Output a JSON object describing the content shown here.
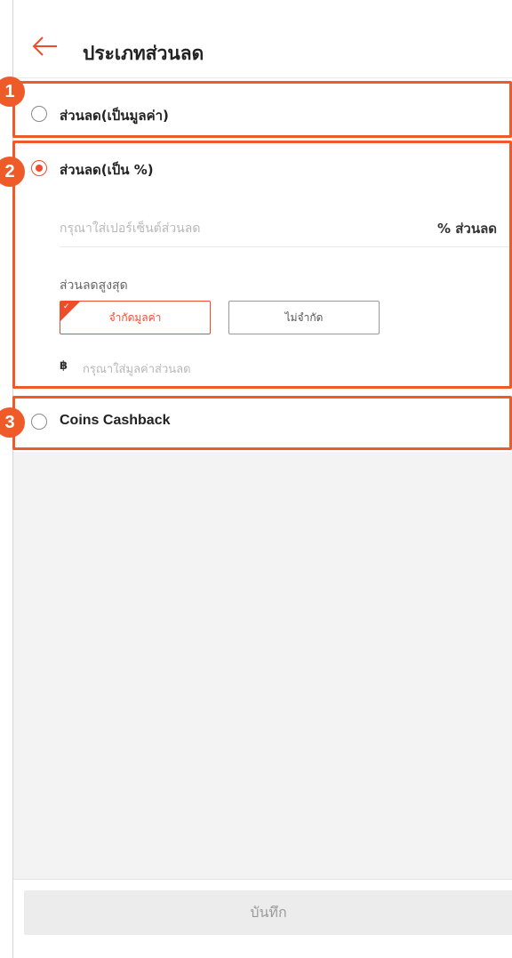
{
  "header": {
    "title": "ประเภทส่วนลด"
  },
  "options": [
    {
      "label": "ส่วนลด(เป็นมูลค่า)",
      "selected": false
    },
    {
      "label": "ส่วนลด(เป็น %)",
      "selected": true
    },
    {
      "label": "Coins Cashback",
      "selected": false
    }
  ],
  "percent_discount": {
    "placeholder": "กรุณาใส่เปอร์เซ็นต์ส่วนลด",
    "suffix": "% ส่วนลด",
    "max_label": "ส่วนลดสูงสุด",
    "limit_options": [
      {
        "label": "จำกัดมูลค่า",
        "active": true
      },
      {
        "label": "ไม่จำกัด",
        "active": false
      }
    ],
    "currency_symbol": "฿",
    "amount_placeholder": "กรุณาใส่มูลค่าส่วนลด"
  },
  "footer": {
    "save_label": "บันทึก"
  },
  "annotations": [
    "1",
    "2",
    "3"
  ],
  "colors": {
    "accent": "#ee4d2d",
    "annotation": "#ee5a28",
    "background_gray": "#f3f3f3"
  }
}
